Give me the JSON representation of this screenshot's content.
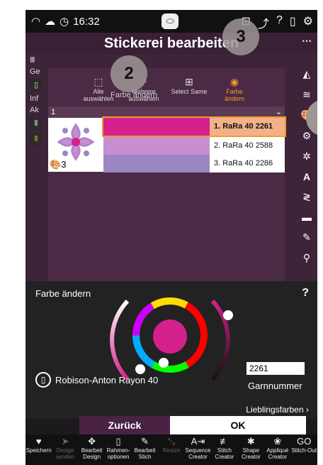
{
  "status": {
    "time": "16:32"
  },
  "title": "Stickerei bearbeiten",
  "subtitle": "Farbe ändern",
  "left_rail": [
    "Ge",
    "Inf",
    "Ak"
  ],
  "toolbar": [
    {
      "label": "Alle auswählen",
      "icon": "select-all-icon"
    },
    {
      "label": "Mehrere auswählen",
      "icon": "multi-select-icon"
    },
    {
      "label": "Select Same",
      "icon": "select-same-icon"
    },
    {
      "label": "Farbe ändern",
      "icon": "color-change-icon",
      "active": true
    }
  ],
  "selector": {
    "value": "1"
  },
  "design": {
    "color_count": "3"
  },
  "colors": [
    {
      "label": "1. RaRa 40 2261",
      "hex": "#d4218c",
      "selected": true
    },
    {
      "label": "2. RaRa 40 2588",
      "hex": "#c78fd0",
      "selected": false
    },
    {
      "label": "3. RaRa 40 2286",
      "hex": "#9c86c4",
      "selected": false
    }
  ],
  "markers": {
    "m2": "2",
    "m3": "3"
  },
  "color_panel": {
    "heading": "Farbe ändern",
    "help": "?",
    "thread_brand": "Robison-Anton Rayon 40",
    "number_value": "2261",
    "number_label": "Garnnummer",
    "favorites": "Lieblingsfarben",
    "selected_hex": "#d4218c"
  },
  "actions": {
    "back": "Zurück",
    "ok": "OK"
  },
  "bottom_bar": [
    {
      "label": "Speichern",
      "icon": "heart-icon"
    },
    {
      "label": "Design senden",
      "icon": "send-icon",
      "disabled": true
    },
    {
      "label": "Bearbeit Design",
      "icon": "edit-design-icon"
    },
    {
      "label": "Rahmen- optionen",
      "icon": "hoop-icon"
    },
    {
      "label": "Bearbeit Stich",
      "icon": "edit-stitch-icon"
    },
    {
      "label": "Resize",
      "icon": "resize-icon",
      "disabled": true
    },
    {
      "label": "Sequence Creator",
      "icon": "sequence-icon"
    },
    {
      "label": "Stitch Creator",
      "icon": "stitch-creator-icon"
    },
    {
      "label": "Shape Creator",
      "icon": "shape-icon"
    },
    {
      "label": "Appliqué Creator",
      "icon": "applique-icon"
    },
    {
      "label": "Stitch-Out",
      "icon": "go-icon"
    }
  ]
}
